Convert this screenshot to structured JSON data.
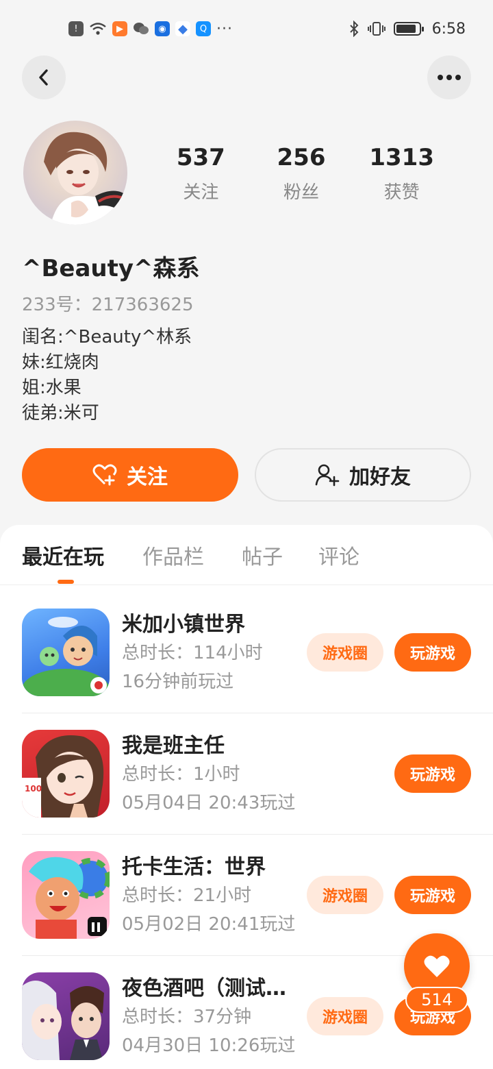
{
  "status_bar": {
    "time": "6:58",
    "icons_left": [
      "alert-icon",
      "wifi-icon",
      "video-app-icon",
      "wechat-icon",
      "bulb-app-icon",
      "browser-icon",
      "search-app-icon",
      "more-dots"
    ],
    "icons_right": [
      "bluetooth-icon",
      "vibrate-icon",
      "battery-icon"
    ]
  },
  "nav": {
    "back_icon": "chevron-left-icon",
    "more_icon": "more-horizontal-icon"
  },
  "profile": {
    "stats": [
      {
        "value": "537",
        "label": "关注"
      },
      {
        "value": "256",
        "label": "粉丝"
      },
      {
        "value": "1313",
        "label": "获赞"
      }
    ],
    "username": "^Beauty^森系",
    "uid": "233号：217363625",
    "bio": [
      "闺名:^Beauty^林系",
      "妹:红烧肉",
      "姐:水果",
      "徒弟:米可"
    ]
  },
  "actions": {
    "follow_label": "关注",
    "add_friend_label": "加好友"
  },
  "tabs": [
    {
      "label": "最近在玩",
      "active": true
    },
    {
      "label": "作品栏",
      "active": false
    },
    {
      "label": "帖子",
      "active": false
    },
    {
      "label": "评论",
      "active": false
    }
  ],
  "games": [
    {
      "name": "米加小镇世界",
      "duration": "总时长：114小时",
      "last_played": "16分钟前玩过",
      "circle_label": "游戏圈",
      "play_label": "玩游戏"
    },
    {
      "name": "我是班主任",
      "duration": "总时长：1小时",
      "last_played": "05月04日 20:43玩过",
      "circle_label": "",
      "play_label": "玩游戏"
    },
    {
      "name": "托卡生活：世界",
      "duration": "总时长：21小时",
      "last_played": "05月02日 20:41玩过",
      "circle_label": "游戏圈",
      "play_label": "玩游戏"
    },
    {
      "name": "夜色酒吧（测试…",
      "duration": "总时长：37分钟",
      "last_played": "04月30日 10:26玩过",
      "circle_label": "游戏圈",
      "play_label": "玩游戏"
    }
  ],
  "like_fab": {
    "count": "514"
  },
  "colors": {
    "accent": "#ff6a13",
    "accent_light": "#ffe9dc",
    "background": "#f5f5f5"
  }
}
